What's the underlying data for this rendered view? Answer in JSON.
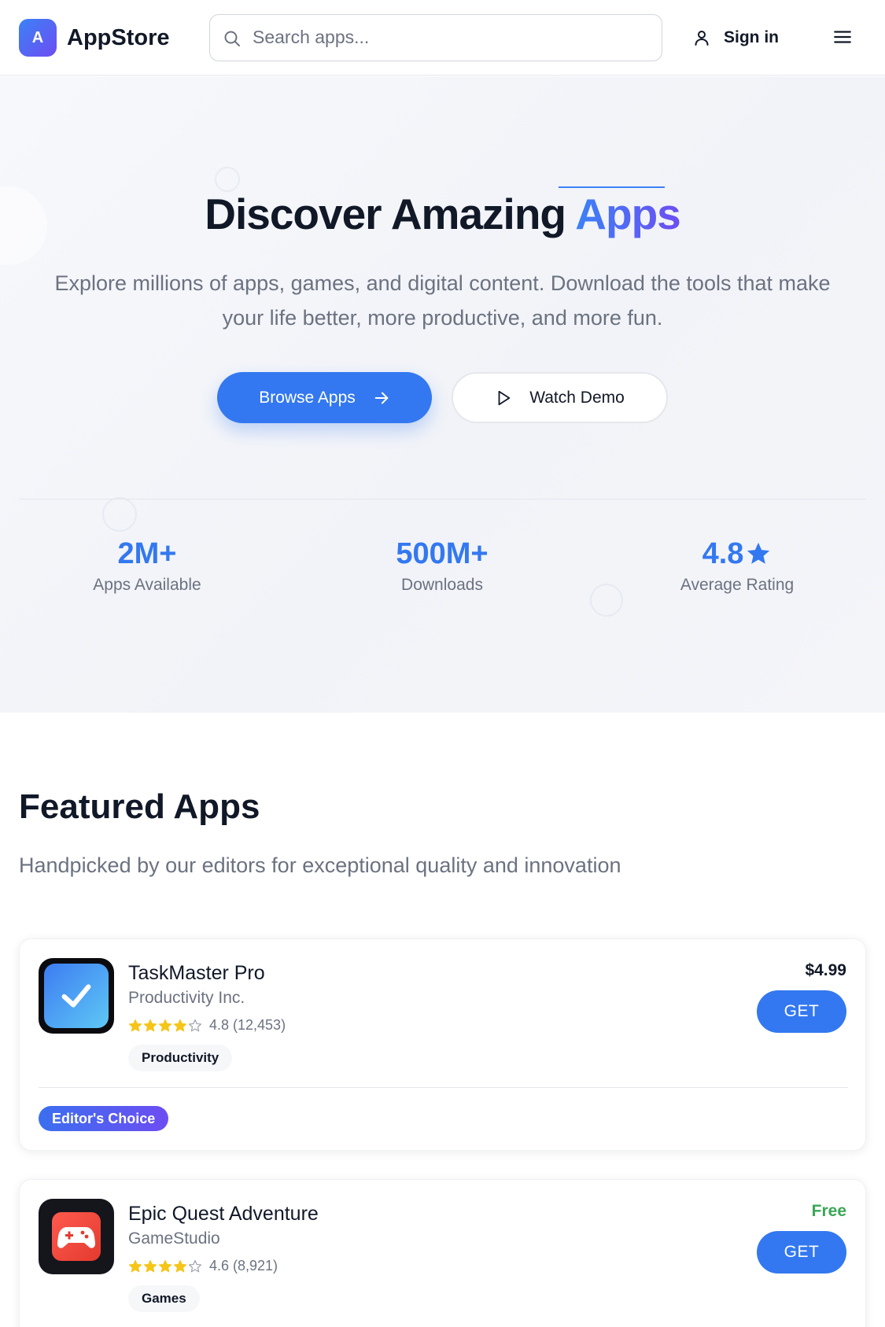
{
  "header": {
    "logo_letter": "A",
    "brand": "AppStore",
    "search_placeholder": "Search apps...",
    "signin_label": "Sign in",
    "icons": {
      "search": "search-icon",
      "user": "user-icon",
      "menu": "hamburger-menu-icon"
    }
  },
  "hero": {
    "title_main": "Discover Amazing ",
    "title_accent": "Apps",
    "subtitle": "Explore millions of apps, games, and digital content. Download the tools that make your life better, more productive, and more fun.",
    "primary_button": "Browse Apps",
    "secondary_button": "Watch Demo",
    "stats": [
      {
        "value": "2M+",
        "label": "Apps Available"
      },
      {
        "value": "500M+",
        "label": "Downloads"
      },
      {
        "value": "4.8",
        "label": "Average Rating"
      }
    ]
  },
  "featured": {
    "title": "Featured Apps",
    "subtitle": "Handpicked by our editors for exceptional quality and innovation",
    "apps": [
      {
        "name": "TaskMaster Pro",
        "developer": "Productivity Inc.",
        "stars": 4.8,
        "rating_text": "4.8 (12,453)",
        "category": "Productivity",
        "price": "$4.99",
        "price_color": "#111827",
        "get_label": "GET",
        "badge": "Editor's Choice",
        "icon": "checkmark-icon"
      },
      {
        "name": "Epic Quest Adventure",
        "developer": "GameStudio",
        "stars": 4.6,
        "rating_text": "4.6 (8,921)",
        "category": "Games",
        "price": "Free",
        "price_color": "#3aa655",
        "get_label": "GET",
        "icon": "gamepad-icon"
      }
    ]
  },
  "colors": {
    "primary": "#3378f0",
    "accent_gradient_end": "#6d4df2",
    "star": "#f5c518"
  }
}
